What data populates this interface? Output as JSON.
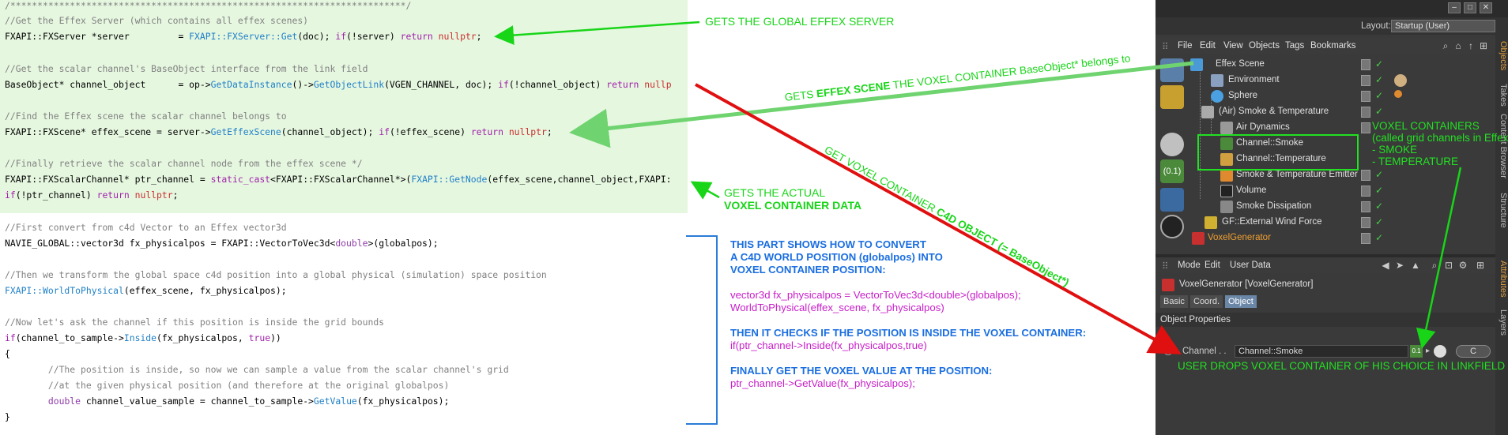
{
  "code": {
    "top_comment": "/*************************************************************************/",
    "l1": "//Get the Effex Server (which contains all effex scenes)",
    "l2a": "FXAPI::FXServer *server         = ",
    "l2b": "FXAPI::FXServer::Get",
    "l2c": "(doc); ",
    "l2d": "if",
    "l2e": "(!server) ",
    "l2f": "return",
    "l2g": " ",
    "l2h": "nullptr",
    "l2i": ";",
    "l3": "//Get the scalar channel's BaseObject interface from the link field",
    "l4a": "BaseObject* channel_object      = op->",
    "l4b": "GetDataInstance",
    "l4c": "()->",
    "l4d": "GetObjectLink",
    "l4e": "(VGEN_CHANNEL, doc); ",
    "l4f": "if",
    "l4g": "(!channel_object) ",
    "l4h": "return",
    "l4i": " nullp",
    "l5": "//Find the Effex scene the scalar channel belongs to",
    "l6a": "FXAPI::FXScene* effex_scene = server->",
    "l6b": "GetEffexScene",
    "l6c": "(channel_object); ",
    "l6d": "if",
    "l6e": "(!effex_scene) ",
    "l6f": "return",
    "l6g": " ",
    "l6h": "nullptr",
    "l6i": ";",
    "l7": "//Finally retrieve the scalar channel node from the effex scene */",
    "l8a": "FXAPI::FXScalarChannel* ptr_channel = ",
    "l8b": "static_cast",
    "l8c": "<FXAPI::FXScalarChannel*>(",
    "l8d": "FXAPI::GetNode",
    "l8e": "(effex_scene,channel_object,FXAPI:",
    "l9a": "if",
    "l9b": "(!ptr_channel) ",
    "l9c": "return",
    "l9d": " ",
    "l9e": "nullptr",
    "l9f": ";",
    "l10": "//First convert from c4d Vector to an Effex vector3d",
    "l11a": "NAVIE_GLOBAL::vector3d fx_physicalpos = FXAPI::VectorToVec3d<",
    "l11b": "double",
    "l11c": ">(globalpos);",
    "l12": "//Then we transform the global space c4d position into a global physical (simulation) space position",
    "l13a": "FXAPI::WorldToPhysical",
    "l13b": "(effex_scene, fx_physicalpos);",
    "l14": "//Now let's ask the channel if this position is inside the grid bounds",
    "l15a": "if",
    "l15b": "(channel_to_sample->",
    "l15c": "Inside",
    "l15d": "(fx_physicalpos, ",
    "l15e": "true",
    "l15f": "))",
    "l16": "{",
    "l17": "        //The position is inside, so now we can sample a value from the scalar channel's grid",
    "l18": "        //at the given physical position (and therefore at the original globalpos)",
    "l19a": "        ",
    "l19b": "double",
    "l19c": " channel_value_sample = channel_to_sample->",
    "l19d": "GetValue",
    "l19e": "(fx_physicalpos);",
    "l20": "}"
  },
  "notes": {
    "gets_server": "GETS THE GLOBAL EFFEX SERVER",
    "gets_actual_1": "GETS THE ACTUAL",
    "gets_actual_2": "VOXEL CONTAINER DATA",
    "effex_scene_pre": "GETS ",
    "effex_scene_bold": "EFFEX SCENE",
    "effex_scene_post": " THE VOXEL CONTAINER BaseObject* belongs to",
    "c4d_obj_pre": "GET VOXEL CONTAINER ",
    "c4d_obj_bold": "C4D OBJECT (= BaseObject*)",
    "voxel_containers_1": "VOXEL CONTAINERS",
    "voxel_containers_2": "(called grid channels in Effex)",
    "voxel_containers_3": "- SMOKE",
    "voxel_containers_4": "- TEMPERATURE",
    "user_drops": "USER DROPS VOXEL CONTAINER OF HIS CHOICE IN LINKFIELD"
  },
  "explain": {
    "p1_1": "THIS PART SHOWS HOW TO CONVERT",
    "p1_2": "A C4D WORLD POSITION (globalpos) INTO",
    "p1_3": "VOXEL CONTAINER POSITION:",
    "p2_1": "vector3d fx_physicalpos = VectorToVec3d<double>(globalpos);",
    "p2_2": "WorldToPhysical(effex_scene, fx_physicalpos)",
    "p3_1": "THEN IT CHECKS IF THE POSITION IS INSIDE THE VOXEL CONTAINER:",
    "p3_2": "if(ptr_channel->Inside(fx_physicalpos,true)",
    "p4_1": "FINALLY GET THE VOXEL VALUE AT THE POSITION:",
    "p4_2": "ptr_channel->GetValue(fx_physicalpos);"
  },
  "c4d": {
    "layout_label": "Layout:",
    "layout_value": "Startup (User)",
    "menu": [
      "File",
      "Edit",
      "View",
      "Objects",
      "Tags",
      "Bookmarks"
    ],
    "objects": [
      {
        "name": "Effex Scene"
      },
      {
        "name": "Environment"
      },
      {
        "name": "Sphere"
      },
      {
        "name": "(Air) Smoke & Temperature"
      },
      {
        "name": "Air Dynamics"
      },
      {
        "name": "Channel::Smoke"
      },
      {
        "name": "Channel::Temperature"
      },
      {
        "name": "Smoke & Temperature Emitter"
      },
      {
        "name": "Volume"
      },
      {
        "name": "Smoke Dissipation"
      },
      {
        "name": "GF::External Wind Force"
      },
      {
        "name": "VoxelGenerator"
      }
    ],
    "side_tabs": [
      "Objects",
      "Takes",
      "Content Browser",
      "Structure",
      "Attributes",
      "Layers"
    ],
    "attr_menu": [
      "Mode",
      "Edit",
      "User Data"
    ],
    "attr_title": "VoxelGenerator [VoxelGenerator]",
    "tabs": [
      "Basic",
      "Coord.",
      "Object"
    ],
    "obj_props": "Object Properties",
    "channel_label": "Channel . .",
    "channel_value": "Channel::Smoke",
    "channel_btn": "C",
    "channel_badge": "0.1",
    "badge_big": "(0.1)"
  },
  "colors": {
    "note_green": "#18d518",
    "arrow_green": "#6fd46f",
    "arrow_red": "#e01010",
    "explain_blue": "#1a6ee0",
    "explain_pink": "#c81ec8"
  }
}
